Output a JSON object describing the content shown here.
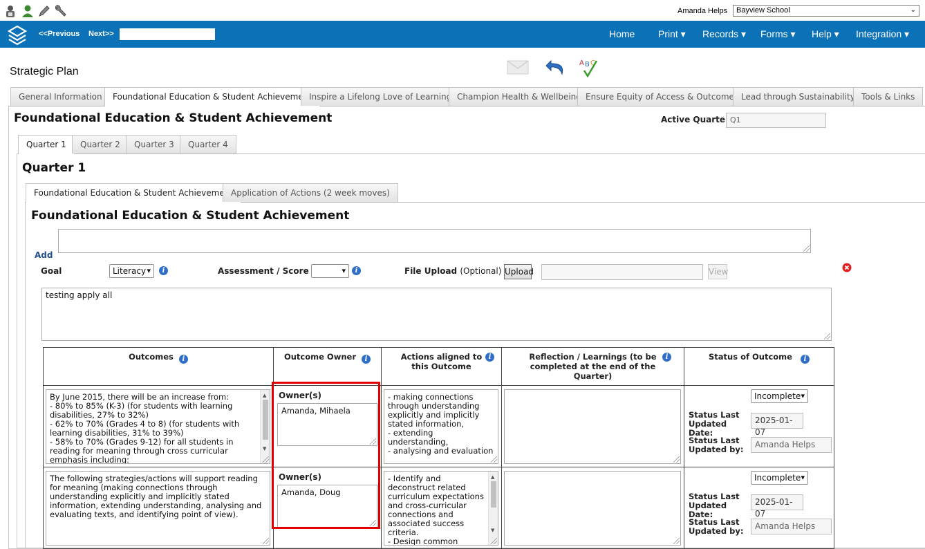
{
  "utility": {
    "icons": [
      "lock-person-icon",
      "user-icon",
      "pencil-icon",
      "wrench-icon"
    ],
    "user_name": "Amanda Helps",
    "school": "Bayview School"
  },
  "nav": {
    "previous": "<<Previous",
    "next": "Next>>",
    "menus": [
      "Home",
      "Print ▾",
      "Records ▾",
      "Forms ▾",
      "Help ▾",
      "Integration ▾"
    ]
  },
  "page": {
    "title": "Strategic Plan"
  },
  "main_tabs": [
    "General Information",
    "Foundational Education & Student Achievement",
    "Inspire a Lifelong Love of Learning",
    "Champion Health & Wellbeing",
    "Ensure Equity of Access & Outcomes",
    "Lead through Sustainability",
    "Tools & Links"
  ],
  "section": {
    "title": "Foundational Education & Student Achievement",
    "active_quarter_label": "Active Quarter",
    "active_quarter_value": "Q1"
  },
  "quarter_tabs": [
    "Quarter 1",
    "Quarter 2",
    "Quarter 3",
    "Quarter 4"
  ],
  "quarter": {
    "title": "Quarter 1"
  },
  "sub_tabs": [
    "Foundational Education & Student Achievement",
    "Application of Actions (2 week moves)"
  ],
  "sub": {
    "title": "Foundational Education & Student Achievement",
    "add_label": "Add",
    "goal_label": "Goal",
    "goal_value": "Literacy",
    "assessment_label": "Assessment / Score",
    "assessment_value": "",
    "file_upload_label": "File Upload",
    "file_upload_optional": "(Optional)",
    "upload_button": "Upload",
    "view_button": "View",
    "goal_text": "testing apply all"
  },
  "table": {
    "headers": {
      "outcomes": "Outcomes",
      "owner": "Outcome Owner",
      "actions": "Actions aligned to this Outcome",
      "reflection": "Reflection / Learnings (to be completed at the end of the Quarter)",
      "status": "Status of Outcome"
    },
    "rows": [
      {
        "outcome": "By June 2015, there will be an increase from:\n- 80% to 85% (K-3) (for students with learning disabilities, 27% to 32%)\n- 62% to 70% (Grades 4 to 8) (for students with learning disabilities, 31% to 39%)\n- 58% to 70% (Grades 9-12) for all students in reading for meaning through cross curricular emphasis including:",
        "owner_label": "Owner(s)",
        "owners": "Amanda, Mihaela",
        "actions": "- making connections through understanding explicitly and implicitly stated information,\n- extending understanding,\n- analysing and evaluation",
        "reflection": "",
        "status": "Incomplete",
        "updated_date_label": "Status Last Updated Date:",
        "updated_date": "2025-01-07",
        "updated_by_label": "Status Last Updated by:",
        "updated_by": "Amanda Helps"
      },
      {
        "outcome": "The following strategies/actions will support reading for meaning (making connections through understanding explicitly and implicitly stated information, extending understanding, analysing and evaluating texts, and identifying point of view).",
        "owner_label": "Owner(s)",
        "owners": "Amanda, Doug",
        "actions": "- Identify and deconstruct related curriculum expectations and cross-curricular connections and associated success criteria.\n- Design common",
        "reflection": "",
        "status": "Incomplete",
        "updated_date_label": "Status Last Updated Date:",
        "updated_date": "2025-01-07",
        "updated_by_label": "Status Last Updated by:",
        "updated_by": "Amanda Helps"
      }
    ]
  },
  "colors": {
    "nav": "#0b72b8",
    "highlight": "#e00000",
    "info": "#2f6fc7",
    "delete": "#e02020"
  }
}
